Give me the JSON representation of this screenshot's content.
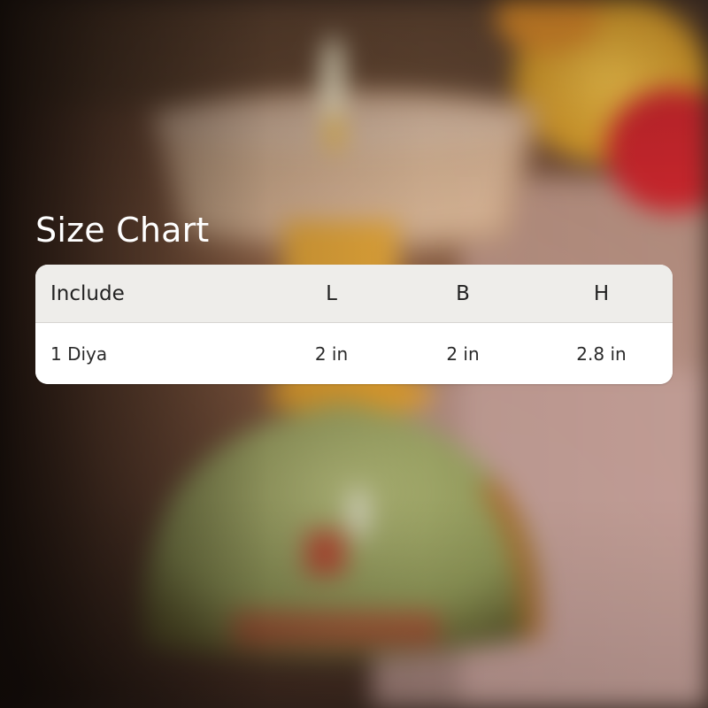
{
  "title": "Size Chart",
  "table": {
    "headers": [
      "Include",
      "L",
      "B",
      "H"
    ],
    "rows": [
      [
        "1 Diya",
        "2 in",
        "2 in",
        "2.8 in"
      ]
    ]
  },
  "colors": {
    "header_bg": "#eeedea",
    "body_bg": "#ffffff",
    "title_text": "#ffffff",
    "table_text": "#2a2a2a"
  }
}
